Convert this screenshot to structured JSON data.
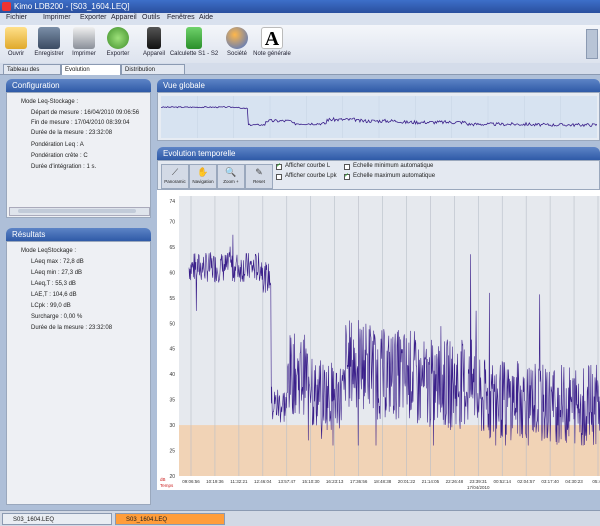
{
  "window": {
    "title": "Kimo LDB200 - [S03_1604.LEQ]"
  },
  "menu": [
    "Fichier",
    "Imprimer",
    "Exporter",
    "Appareil",
    "Outils",
    "Fenêtres",
    "Aide"
  ],
  "toolbar": [
    {
      "label": "Ouvrir",
      "icon": "folder-icon"
    },
    {
      "label": "Enregistrer",
      "icon": "save-icon"
    },
    {
      "label": "Imprimer",
      "icon": "printer-icon"
    },
    {
      "label": "Exporter",
      "icon": "export-icon"
    },
    {
      "label": "Appareil",
      "icon": "device-icon"
    },
    {
      "label": "Calculette S1 - S2",
      "icon": "calculator-icon"
    },
    {
      "label": "Société",
      "icon": "company-icon"
    },
    {
      "label": "Note générale",
      "icon": "note-icon"
    }
  ],
  "tabs": [
    "Tableau des valeurs",
    "Evolution temporelle",
    "Distribution statistiques"
  ],
  "active_tab": 1,
  "configuration": {
    "title": "Configuration",
    "mode": "Mode Leq-Stockage :",
    "lines": [
      "Départ de mesure : 16/04/2010 09:06:56",
      "Fin de mesure : 17/04/2010 08:39:04",
      "Durée de la mesure : 23:32:08",
      "Pondération Leq : A",
      "Pondération crête : C",
      "Durée d'intégration : 1 s."
    ]
  },
  "results": {
    "title": "Résultats",
    "mode": "Mode LeqStockage :",
    "lines": [
      "LAeq max : 72,8 dB",
      "LAeq min : 27,3 dB",
      "LAeq,T : 55,3 dB",
      "LAE,T : 104,6 dB",
      "LCpk : 99,0 dB",
      "Surcharge : 0,00 %",
      "Durée de la mesure : 23:32:08"
    ]
  },
  "overview": {
    "title": "Vue globale"
  },
  "evolution": {
    "title": "Evolution temporelle",
    "tools": [
      "Panoramic",
      "Navigation",
      "Zoom +",
      "Reset"
    ],
    "options": [
      {
        "label": "Afficher courbe L",
        "checked": true
      },
      {
        "label": "Echelle minimum automatique",
        "checked": false
      },
      {
        "label": "Afficher courbe Lpk",
        "checked": false
      },
      {
        "label": "Echelle maximum automatique",
        "checked": true
      }
    ]
  },
  "statusbar": {
    "files": [
      "S03_1604.LEQ",
      "S03_1604.LEQ"
    ]
  },
  "colors": {
    "line": "#3a1f8a",
    "band": "#f1d3b6",
    "header": "#2f5aa7"
  },
  "chart_data": {
    "type": "line",
    "y_ticks": [
      20,
      25,
      30,
      35,
      40,
      45,
      50,
      55,
      60,
      65,
      70,
      74
    ],
    "ylim": [
      20,
      75
    ],
    "y_unit": "dB",
    "x_ticks": [
      "09:06:56",
      "10:19:36",
      "11:32:21",
      "12:46:04",
      "13:57:47",
      "15:10:30",
      "16:23:13",
      "17:36:56",
      "18:48:38",
      "20:01:22",
      "21:14:05",
      "22:26:48",
      "23:39:31",
      "00:52:14",
      "02:04:57",
      "03:17:40",
      "04:30:23",
      "05:43"
    ],
    "x_subtick": "17/04/2010",
    "x_axis_corner": [
      "dB",
      "Temps"
    ],
    "reference_band": [
      20,
      30
    ],
    "segments": [
      {
        "from": 0.0,
        "to": 0.18,
        "level": 61,
        "noise": 3
      },
      {
        "from": 0.18,
        "to": 0.2,
        "level": 59,
        "noise": 3
      },
      {
        "from": 0.2,
        "to": 0.24,
        "level": 34,
        "noise": 4
      },
      {
        "from": 0.24,
        "to": 0.3,
        "level": 40,
        "noise": 8
      },
      {
        "from": 0.3,
        "to": 0.38,
        "level": 36,
        "noise": 7
      },
      {
        "from": 0.38,
        "to": 0.45,
        "level": 42,
        "noise": 9
      },
      {
        "from": 0.45,
        "to": 0.55,
        "level": 40,
        "noise": 9
      },
      {
        "from": 0.55,
        "to": 0.7,
        "level": 38,
        "noise": 9
      },
      {
        "from": 0.7,
        "to": 0.85,
        "level": 35,
        "noise": 8
      },
      {
        "from": 0.85,
        "to": 1.0,
        "level": 34,
        "noise": 8
      }
    ]
  }
}
